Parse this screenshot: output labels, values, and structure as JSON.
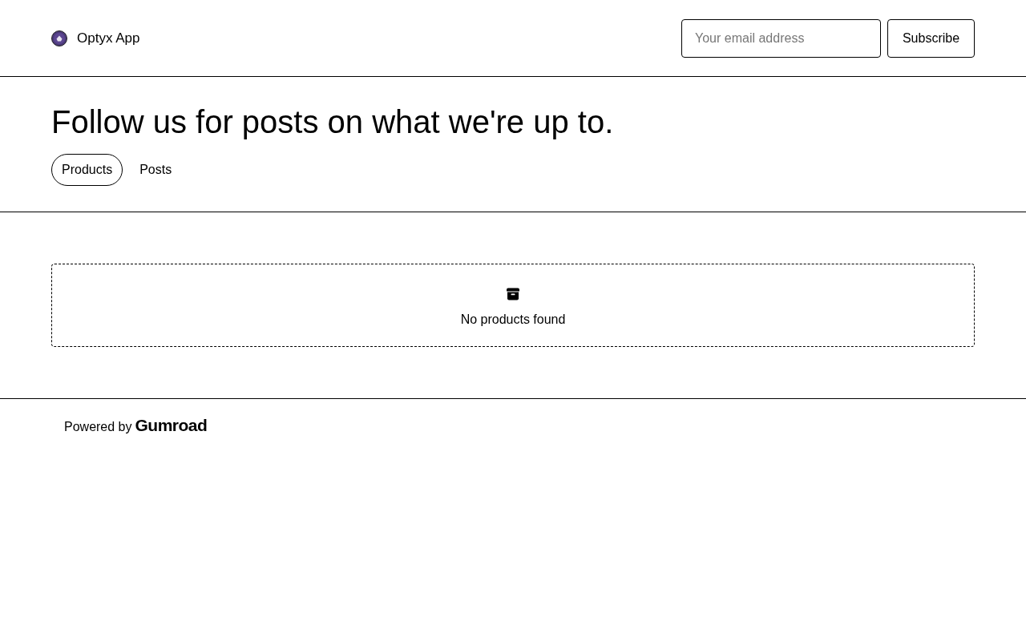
{
  "header": {
    "site_title": "Optyx App",
    "email_field": {
      "placeholder": "Your email address"
    },
    "subscribe_button": "Subscribe"
  },
  "hero": {
    "heading": "Follow us for posts on what we're up to.",
    "tabs": [
      {
        "label": "Products",
        "selected": true
      },
      {
        "label": "Posts",
        "selected": false
      }
    ]
  },
  "empty_state": {
    "message": "No products found"
  },
  "footer": {
    "powered_by": "Powered by",
    "logo_text": "Gumroad"
  }
}
